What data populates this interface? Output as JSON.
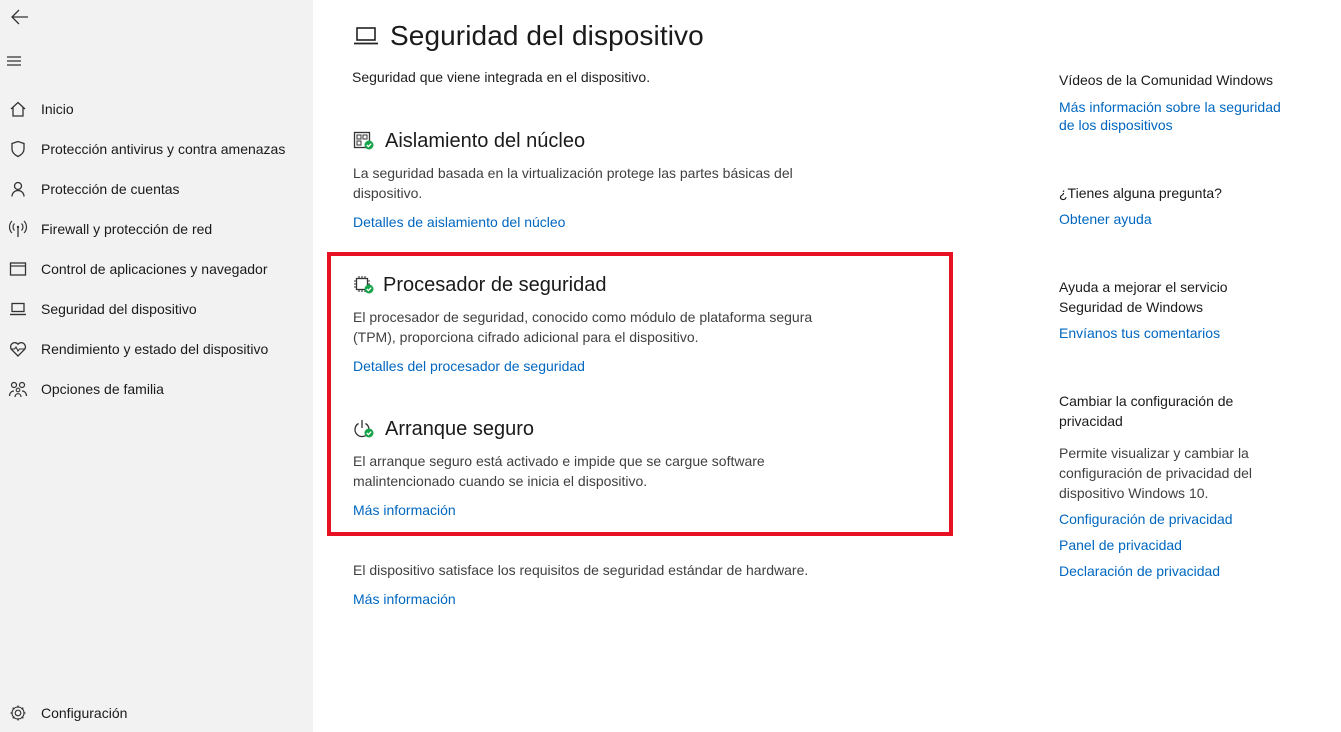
{
  "sidebar": {
    "items": [
      {
        "label": "Inicio",
        "icon": "home-icon"
      },
      {
        "label": "Protección antivirus y contra amenazas",
        "icon": "shield-icon"
      },
      {
        "label": "Protección de cuentas",
        "icon": "person-icon"
      },
      {
        "label": "Firewall y protección de red",
        "icon": "wifi-icon"
      },
      {
        "label": "Control de aplicaciones y navegador",
        "icon": "browser-window-icon"
      },
      {
        "label": "Seguridad del dispositivo",
        "icon": "laptop-icon"
      },
      {
        "label": "Rendimiento y estado del dispositivo",
        "icon": "heart-pulse-icon"
      },
      {
        "label": "Opciones de familia",
        "icon": "family-icon"
      }
    ],
    "settings_label": "Configuración"
  },
  "main": {
    "title": "Seguridad del dispositivo",
    "subtitle": "Seguridad que viene integrada en el dispositivo.",
    "sections": [
      {
        "title": "Aislamiento del núcleo",
        "description": "La seguridad basada en la virtualización protege las partes básicas del dispositivo.",
        "link": "Detalles de aislamiento del núcleo"
      },
      {
        "title": "Procesador de seguridad",
        "description": "El procesador de seguridad, conocido como módulo de plataforma segura (TPM), proporciona cifrado adicional para el dispositivo.",
        "link": "Detalles del procesador de seguridad"
      },
      {
        "title": "Arranque seguro",
        "description": "El arranque seguro está activado e impide que se cargue software malintencionado cuando se inicia el dispositivo.",
        "link": "Más información"
      }
    ],
    "footer_text": "El dispositivo satisface los requisitos de seguridad estándar de hardware.",
    "footer_link": "Más información"
  },
  "right": {
    "videos": {
      "title": "Vídeos de la Comunidad Windows",
      "link": "Más información sobre la seguridad de los dispositivos"
    },
    "question": {
      "title": "¿Tienes alguna pregunta?",
      "link": "Obtener ayuda"
    },
    "improve": {
      "title": "Ayuda a mejorar el servicio Seguridad de Windows",
      "link": "Envíanos tus comentarios"
    },
    "privacy": {
      "title": "Cambiar la configuración de privacidad",
      "text": "Permite visualizar y cambiar la configuración de privacidad del dispositivo Windows 10.",
      "links": [
        "Configuración de privacidad",
        "Panel de privacidad",
        "Declaración de privacidad"
      ]
    }
  },
  "colors": {
    "accent": "#0067c0",
    "highlight": "#e81123",
    "sidebar_bg": "#f2f2f2",
    "status_ok": "#16a34a"
  }
}
